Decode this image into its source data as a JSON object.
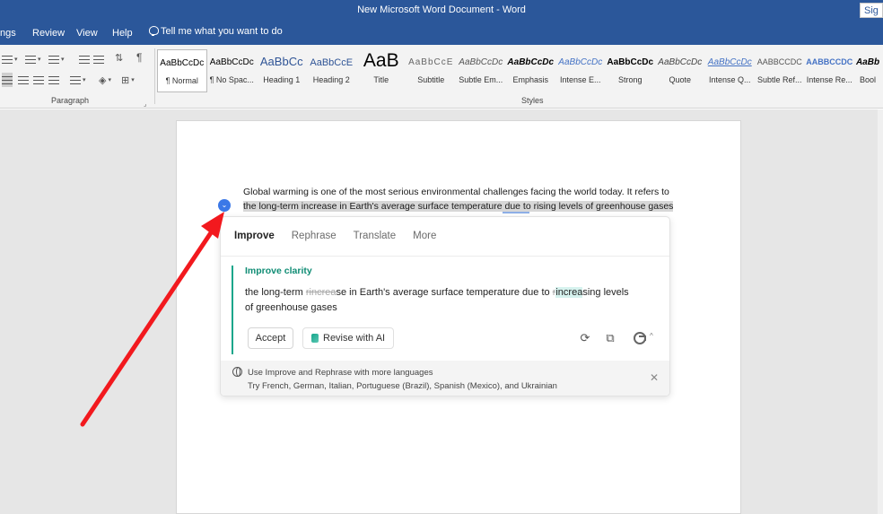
{
  "window": {
    "title": "New Microsoft Word Document  -  Word",
    "signin": "Sig"
  },
  "menu": {
    "tabs": [
      "ngs",
      "Review",
      "View",
      "Help"
    ],
    "tell_me": "Tell me what you want to do"
  },
  "ribbon": {
    "paragraph_label": "Paragraph",
    "styles_label": "Styles",
    "styles": [
      {
        "sample": "AaBbCcDc",
        "name": "¶ Normal"
      },
      {
        "sample": "AaBbCcDc",
        "name": "¶ No Spac..."
      },
      {
        "sample": "AaBbCc",
        "name": "Heading 1"
      },
      {
        "sample": "AaBbCcE",
        "name": "Heading 2"
      },
      {
        "sample": "AaB",
        "name": "Title"
      },
      {
        "sample": "AaBbCcE",
        "name": "Subtitle"
      },
      {
        "sample": "AaBbCcDc",
        "name": "Subtle Em..."
      },
      {
        "sample": "AaBbCcDc",
        "name": "Emphasis"
      },
      {
        "sample": "AaBbCcDc",
        "name": "Intense E..."
      },
      {
        "sample": "AaBbCcDc",
        "name": "Strong"
      },
      {
        "sample": "AaBbCcDc",
        "name": "Quote"
      },
      {
        "sample": "AaBbCcDc",
        "name": "Intense Q..."
      },
      {
        "sample": "AABBCCDC",
        "name": "Subtle Ref..."
      },
      {
        "sample": "AABBCCDC",
        "name": "Intense Re..."
      },
      {
        "sample": "AaBb",
        "name": "Bool"
      }
    ]
  },
  "document": {
    "line1": "Global warming is one of the most serious environmental challenges facing the world today. It refers to",
    "line2": "the long-term increase in Earth's average surface temperature due to rising levels of greenhouse gases"
  },
  "assistant": {
    "tabs": [
      "Improve",
      "Rephrase",
      "Translate",
      "More"
    ],
    "suggestion_title": "Improve clarity",
    "suggestion": {
      "before": "the long-term ",
      "deleted": "rincrea",
      "middle": "se in Earth's average surface temperature due to ",
      "deleted2": "r",
      "inserted": "increa",
      "after": "sing levels",
      "line2": "of greenhouse gases"
    },
    "accept": "Accept",
    "revise": "Revise with AI",
    "footer_title": "Use Improve and Rephrase with more languages",
    "footer_text": "Try French, German, Italian, Portuguese (Brazil), Spanish (Mexico), and Ukrainian"
  },
  "colors": {
    "word_blue": "#2b579a",
    "accent_green": "#16a68b",
    "arrow_red": "#f2191e"
  }
}
